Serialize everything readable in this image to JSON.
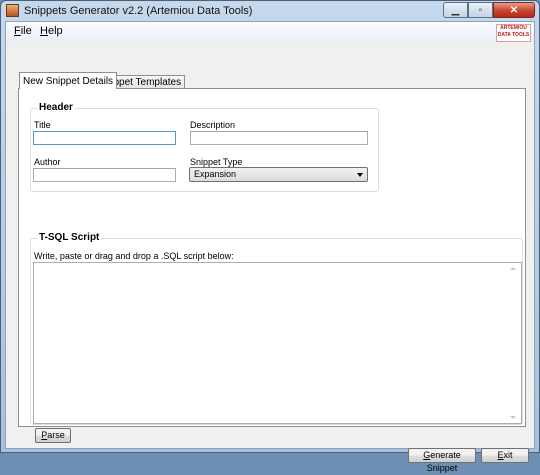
{
  "window": {
    "title": "Snippets Generator v2.2 (Artemiou Data Tools)",
    "minimize_icon": "minimize-icon",
    "maximize_icon": "maximize-icon",
    "close_icon": "close-icon"
  },
  "menu": {
    "file": {
      "accel": "F",
      "rest": "ile"
    },
    "help": {
      "accel": "H",
      "rest": "elp"
    }
  },
  "logo": {
    "line1": "ARTEMIOU",
    "line2": "DATA TOOLS"
  },
  "tabs": [
    {
      "label": "New Snippet Details",
      "active": true
    },
    {
      "label": "Snippet Templates",
      "active": false
    }
  ],
  "header_group": {
    "title": "Header",
    "title_label": "Title",
    "title_value": "",
    "description_label": "Description",
    "description_value": "",
    "author_label": "Author",
    "author_value": "",
    "snippet_type_label": "Snippet Type",
    "snippet_type_value": "Expansion"
  },
  "script_group": {
    "title": "T-SQL Script",
    "instruction": "Write, paste or drag and drop a .SQL script below:",
    "script_value": "",
    "parse_button": {
      "accel": "P",
      "rest": "arse"
    }
  },
  "footer": {
    "generate_button": {
      "accel": "G",
      "rest": "enerate Snippet"
    },
    "exit_button": {
      "accel": "E",
      "rest": "xit"
    }
  }
}
